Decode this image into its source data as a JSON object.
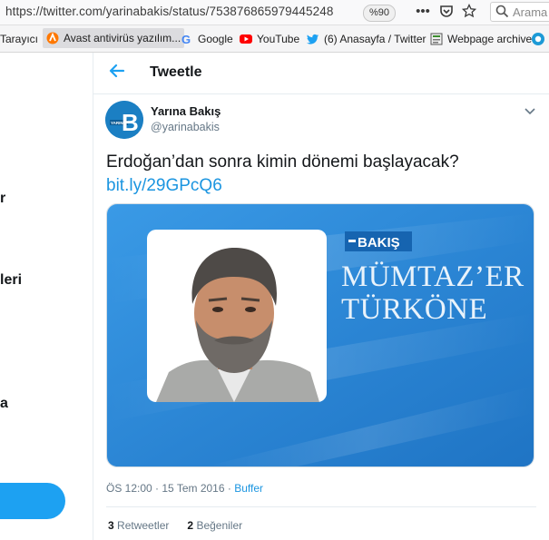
{
  "browser": {
    "url": "https://twitter.com/yarinabakis/status/753876865979445248",
    "zoom": "%90",
    "search_placeholder": "Arama",
    "bookmarks": [
      {
        "label": "Tarayıcı"
      },
      {
        "label": "Avast antivirüs yazılım..."
      },
      {
        "label": "Google"
      },
      {
        "label": "YouTube"
      },
      {
        "label": "(6) Anasayfa / Twitter"
      },
      {
        "label": "Webpage archive"
      }
    ]
  },
  "sidebar_fragments": [
    "r",
    "leri",
    "a"
  ],
  "header": {
    "title": "Tweetle"
  },
  "tweet": {
    "author_name": "Yarına Bakış",
    "author_handle": "@yarinabakis",
    "avatar_letter": "B",
    "avatar_tag": "YARINA",
    "text": "Erdoğan’dan sonra kimin dönemi başlayacak? ",
    "link": "bit.ly/29GPcQ6",
    "media": {
      "logo_text": "BAKIŞ",
      "headline_line1": "MÜMTAZ’ER",
      "headline_line2": "TÜRKÖNE"
    },
    "time": "ÖS 12:00 · 15 Tem 2016 · ",
    "source": "Buffer",
    "retweets_count": "3",
    "retweets_label": "Retweetler",
    "likes_count": "2",
    "likes_label": "Beğeniler"
  },
  "colors": {
    "accent": "#1da1f2",
    "link": "#1b95e0",
    "media_bg": "#2a86d6"
  }
}
